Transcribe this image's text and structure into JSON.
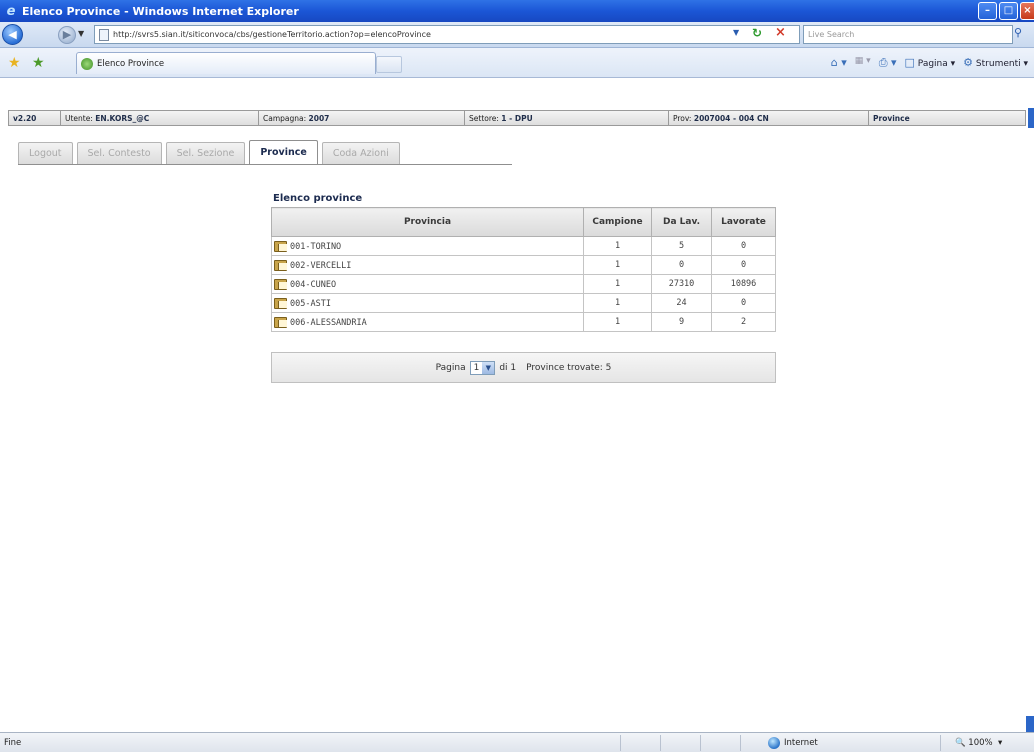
{
  "browser": {
    "window_title": "Elenco Province - Windows Internet Explorer",
    "address": "http://svrs5.sian.it/siticonvoca/cbs/gestioneTerritorio.action?op=elencoProvince",
    "search_placeholder": "Live Search",
    "tab_title": "Elenco Province",
    "cmd_page": "Pagina",
    "cmd_tools": "Strumenti",
    "status_text": "Fine",
    "zone": "Internet",
    "zoom": "100%"
  },
  "header": {
    "version": "v2.20",
    "user_label": "Utente:",
    "user_value": "EN.KORS_@C",
    "campaign_label": "Campagna:",
    "campaign_value": "2007",
    "sector_label": "Settore:",
    "sector_value": "1 - DPU",
    "prov_label": "Prov:",
    "prov_value": "2007004 - 004 CN",
    "section": "Province"
  },
  "tabs": [
    {
      "label": "Logout"
    },
    {
      "label": "Sel. Contesto"
    },
    {
      "label": "Sel. Sezione"
    },
    {
      "label": "Province",
      "active": true
    },
    {
      "label": "Coda Azioni"
    }
  ],
  "list": {
    "title": "Elenco province",
    "columns": [
      "Provincia",
      "Campione",
      "Da Lav.",
      "Lavorate"
    ],
    "rows": [
      {
        "provincia": "001-TORINO",
        "campione": "1",
        "da_lav": "5",
        "lavorate": "0"
      },
      {
        "provincia": "002-VERCELLI",
        "campione": "1",
        "da_lav": "0",
        "lavorate": "0"
      },
      {
        "provincia": "004-CUNEO",
        "campione": "1",
        "da_lav": "27310",
        "lavorate": "10896"
      },
      {
        "provincia": "005-ASTI",
        "campione": "1",
        "da_lav": "24",
        "lavorate": "0"
      },
      {
        "provincia": "006-ALESSANDRIA",
        "campione": "1",
        "da_lav": "9",
        "lavorate": "2"
      }
    ]
  },
  "pager": {
    "page_label": "Pagina",
    "page_value": "1",
    "of_label": "di 1",
    "found_label": "Province trovate: 5"
  }
}
